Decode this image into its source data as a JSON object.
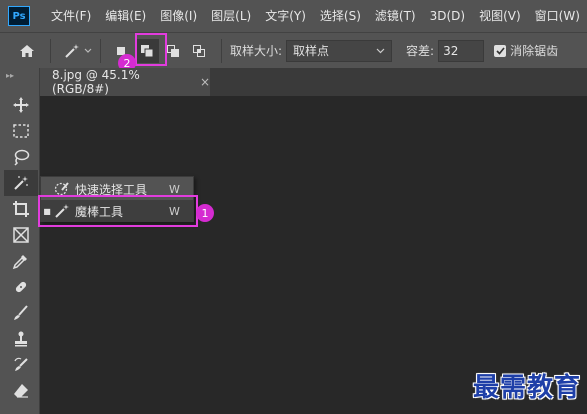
{
  "app": {
    "logo_text": "Ps"
  },
  "menubar": {
    "items": [
      "文件(F)",
      "编辑(E)",
      "图像(I)",
      "图层(L)",
      "文字(Y)",
      "选择(S)",
      "滤镜(T)",
      "3D(D)",
      "视图(V)",
      "窗口(W)"
    ]
  },
  "options": {
    "sample_size_label": "取样大小:",
    "sample_size_value": "取样点",
    "tolerance_label": "容差:",
    "tolerance_value": "32",
    "antialias_label": "消除锯齿",
    "antialias_checked": true
  },
  "document_tab": {
    "title": "8.jpg @ 45.1%(RGB/8#)",
    "close_glyph": "×"
  },
  "flyout": {
    "items": [
      {
        "label": "快速选择工具",
        "shortcut": "W",
        "selected": false
      },
      {
        "label": "魔棒工具",
        "shortcut": "W",
        "selected": true
      }
    ]
  },
  "annotations": {
    "badge_1": "1",
    "badge_2": "2",
    "highlight_color": "#e23cde"
  },
  "toolbar": {
    "tools": [
      "move-tool",
      "marquee-tool",
      "lasso-tool",
      "magic-wand-tool",
      "crop-tool",
      "frame-tool",
      "eyedropper-tool",
      "healing-brush-tool",
      "brush-tool",
      "clone-stamp-tool",
      "history-brush-tool",
      "eraser-tool"
    ]
  },
  "watermark": {
    "text": "最需教育"
  }
}
